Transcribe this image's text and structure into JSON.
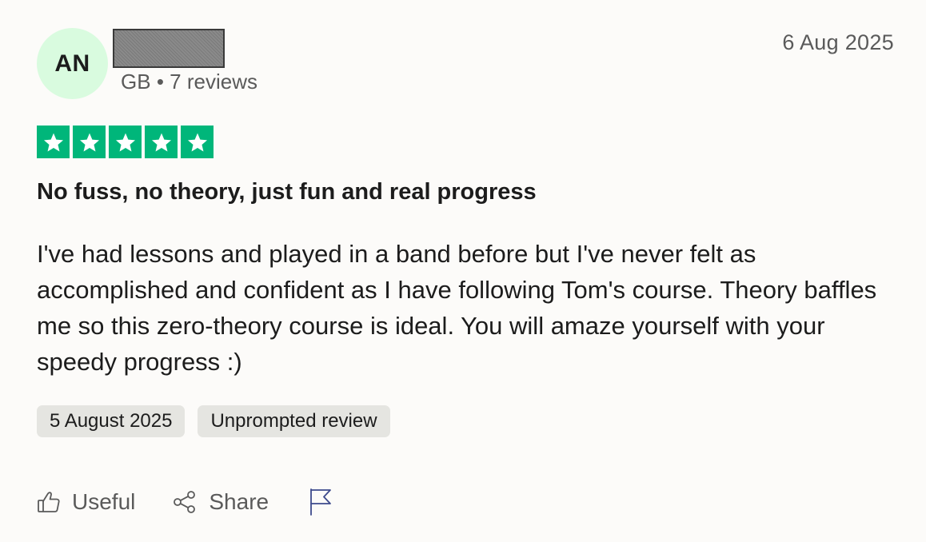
{
  "reviewer": {
    "initials": "AN",
    "country": "GB",
    "separator": "•",
    "reviews_count": "7 reviews"
  },
  "review": {
    "posted_date": "6 Aug 2025",
    "rating": 5,
    "rating_color": "#00b67a",
    "title": "No fuss, no theory, just fun and real progress",
    "body": "I've had lessons and played in a band before but I've never felt as accomplished and confident as I have following Tom's course. Theory baffles me so this zero-theory course is ideal. You will amaze yourself with your speedy progress :)",
    "tags": [
      {
        "label": "5 August 2025"
      },
      {
        "label": "Unprompted review"
      }
    ]
  },
  "actions": {
    "useful_label": "Useful",
    "share_label": "Share",
    "useful_icon": "thumbs-up-icon",
    "share_icon": "share-icon",
    "report_icon": "flag-icon"
  }
}
